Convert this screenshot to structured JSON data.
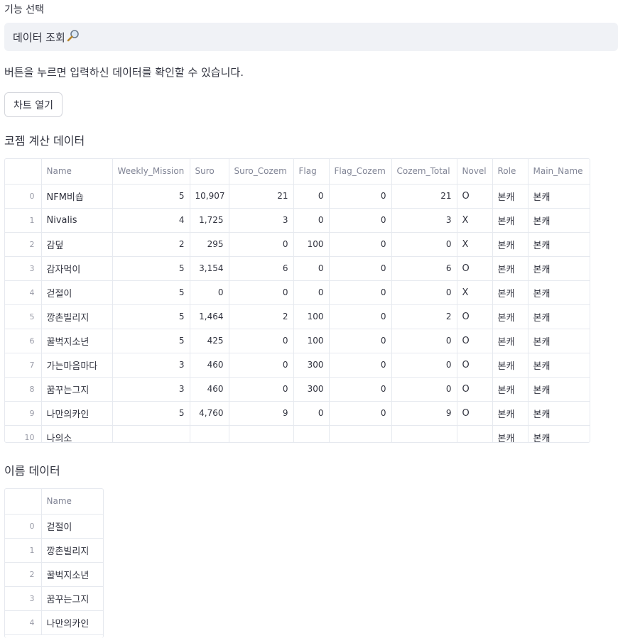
{
  "feature_label": "기능 선택",
  "select_value": "데이터 조회",
  "select_icon": "magnifier-icon",
  "description": "버튼을 누르면 입력하신 데이터를 확인할 수 있습니다.",
  "chart_button": "차트 열기",
  "table1": {
    "title": "코젬 계산 데이터",
    "columns": [
      "",
      "Name",
      "Weekly_Mission",
      "Suro",
      "Suro_Cozem",
      "Flag",
      "Flag_Cozem",
      "Cozem_Total",
      "Novel",
      "Role",
      "Main_Name"
    ],
    "rows": [
      [
        "0",
        "NFM비숍",
        "5",
        "10,907",
        "21",
        "0",
        "0",
        "21",
        "O",
        "본캐",
        "본캐"
      ],
      [
        "1",
        "Nivalis",
        "4",
        "1,725",
        "3",
        "0",
        "0",
        "3",
        "X",
        "본캐",
        "본캐"
      ],
      [
        "2",
        "감덮",
        "2",
        "295",
        "0",
        "100",
        "0",
        "0",
        "X",
        "본캐",
        "본캐"
      ],
      [
        "3",
        "감자먹이",
        "5",
        "3,154",
        "6",
        "0",
        "0",
        "6",
        "O",
        "본캐",
        "본캐"
      ],
      [
        "4",
        "걷절이",
        "5",
        "0",
        "0",
        "0",
        "0",
        "0",
        "X",
        "본캐",
        "본캐"
      ],
      [
        "5",
        "깡촌빌리지",
        "5",
        "1,464",
        "2",
        "100",
        "0",
        "2",
        "O",
        "본캐",
        "본캐"
      ],
      [
        "6",
        "꿀벅지소년",
        "5",
        "425",
        "0",
        "100",
        "0",
        "0",
        "O",
        "본캐",
        "본캐"
      ],
      [
        "7",
        "가는마음마다",
        "3",
        "460",
        "0",
        "300",
        "0",
        "0",
        "O",
        "본캐",
        "본캐"
      ],
      [
        "8",
        "꿈꾸는그지",
        "3",
        "460",
        "0",
        "300",
        "0",
        "0",
        "O",
        "본캐",
        "본캐"
      ],
      [
        "9",
        "나만의카인",
        "5",
        "4,760",
        "9",
        "0",
        "0",
        "9",
        "O",
        "본캐",
        "본캐"
      ],
      [
        "10",
        "나의소",
        "",
        "",
        "",
        "",
        "",
        "",
        "",
        "본캐",
        "본캐"
      ]
    ]
  },
  "table2": {
    "title": "이름 데이터",
    "columns": [
      "",
      "Name"
    ],
    "rows": [
      [
        "0",
        "걷절이"
      ],
      [
        "1",
        "깡촌빌리지"
      ],
      [
        "2",
        "꿀벅지소년"
      ],
      [
        "3",
        "꿈꾸는그지"
      ],
      [
        "4",
        "나만의카인"
      ]
    ]
  }
}
